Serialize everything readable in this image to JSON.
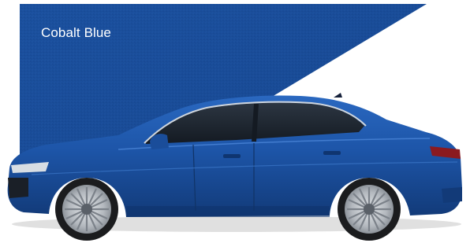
{
  "swatch": {
    "label": "Cobalt Blue",
    "color": "#1a4e9b",
    "color_dark": "#133c7d"
  },
  "car": {
    "icon": "sedan-side-view-image",
    "body_color": "#1d55a8",
    "body_shadow": "#123a78",
    "window_color": "#1d2631",
    "wheel_color": "#b9bec4",
    "tire_color": "#1b1c1e"
  }
}
